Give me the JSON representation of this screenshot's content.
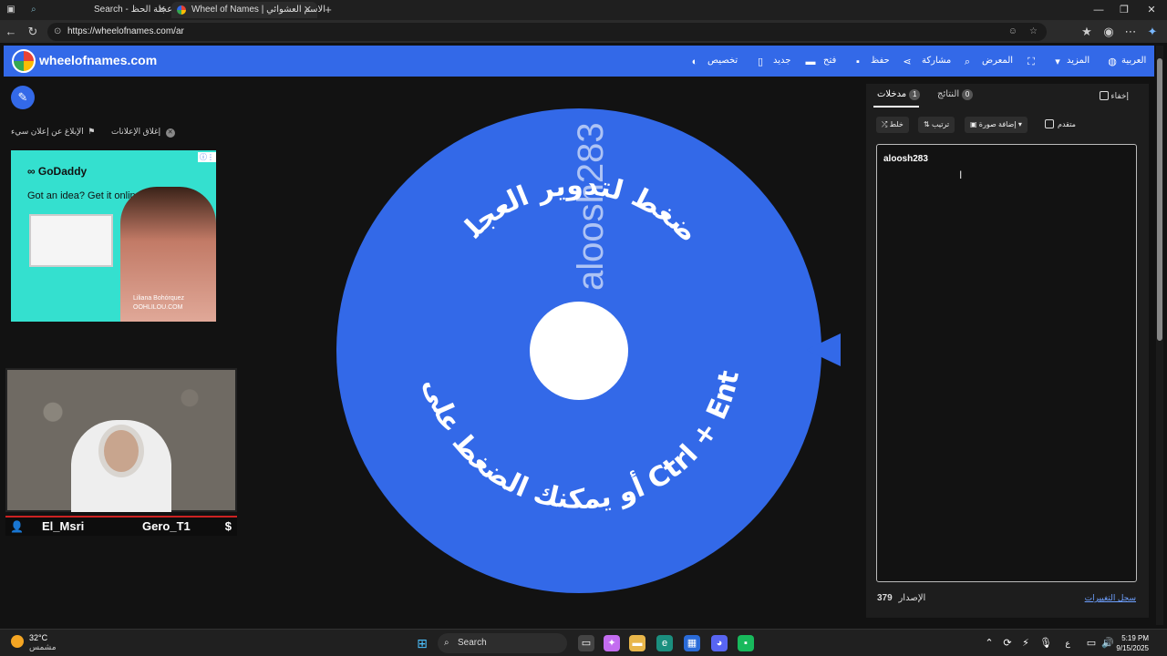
{
  "browser": {
    "tabs": [
      {
        "title": "Search - عجلة الحظ"
      },
      {
        "title": "Wheel of Names | الاسم العشوائي"
      }
    ],
    "url": "https://wheelofnames.com/ar"
  },
  "site": {
    "logo": "wheelofnames.com",
    "menu": [
      {
        "label": "العربية",
        "icon": "globe-icon"
      },
      {
        "label": "المزيد",
        "icon": "caret-down-icon"
      },
      {
        "label": "",
        "icon": "fullscreen-icon"
      },
      {
        "label": "المعرض",
        "icon": "search-icon"
      },
      {
        "label": "مشاركة",
        "icon": "share-icon"
      },
      {
        "label": "حفظ",
        "icon": "save-icon"
      },
      {
        "label": "فتح",
        "icon": "folder-icon"
      },
      {
        "label": "جديد",
        "icon": "file-icon"
      },
      {
        "label": "تخصيص",
        "icon": "palette-icon"
      }
    ]
  },
  "ads": {
    "close_ads": "إغلاق الإعلانات",
    "report_ad": "الإبلاغ عن إعلان سيء",
    "brand": "GoDaddy",
    "tagline": "Got an idea? Get it online.",
    "caption_name": "Liliana Bohórquez",
    "caption_site": "OOHLILOU.COM"
  },
  "stream": {
    "left_name": "El_Msri",
    "right_name": "Gero_T1"
  },
  "wheel": {
    "entry_text": "aloosh283",
    "top_instruction": "اضغط لتدوير العجلة",
    "bottom_instruction": "أو يمكنك الضغط على زر Ctrl + Enter",
    "color": "#3369e8"
  },
  "panel": {
    "hide_label": "إخفاء",
    "tabs": [
      {
        "label": "النتائج",
        "count": "0"
      },
      {
        "label": "مدخلات",
        "count": "1"
      }
    ],
    "tools": {
      "shuffle": "خلط",
      "sort": "ترتيب",
      "add_image": "إضافة صورة",
      "advanced": "متقدم"
    },
    "entries": [
      "aloosh283"
    ],
    "version_label": "الإصدار",
    "version_number": "379",
    "changelog": "سجل التغييرات"
  },
  "taskbar": {
    "temperature": "32°C",
    "weather": "مشمس",
    "search": "Search",
    "lang": "ع",
    "time": "5:19 PM",
    "date": "9/15/2025"
  }
}
